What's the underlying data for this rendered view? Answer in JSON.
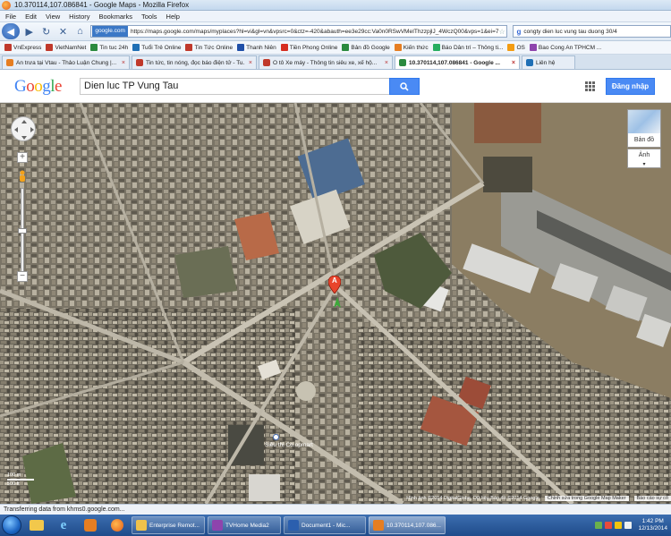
{
  "window": {
    "title": "10.370114,107.086841 - Google Maps - Mozilla Firefox"
  },
  "menu": [
    "File",
    "Edit",
    "View",
    "History",
    "Bookmarks",
    "Tools",
    "Help"
  ],
  "nav": {
    "site_label": "google.com",
    "url": "https://maps.google.com/maps/myplaces?hl=vi&gl=vn&vpsrc=0&ctz=-420&abauth=ee3e29cc:Va0n0RSwVMeIThzzpjlJ_4WczQ00&vps=1&ei=7",
    "search_value": "congty dien luc vung tau duong 30/4"
  },
  "bookmarks": [
    {
      "label": "VnExpress",
      "color": "#c0392b"
    },
    {
      "label": "VietNamNet",
      "color": "#c0392b"
    },
    {
      "label": "Tin tuc 24h",
      "color": "#2b8a3e"
    },
    {
      "label": "Tuổi Trẻ Online",
      "color": "#1f6fb5"
    },
    {
      "label": "Tin Tức Online",
      "color": "#c0392b"
    },
    {
      "label": "Thanh Niên",
      "color": "#1f4fa8"
    },
    {
      "label": "Tiền Phong Online",
      "color": "#d62d20"
    },
    {
      "label": "Bản đồ Google",
      "color": "#2b8a3e"
    },
    {
      "label": "Kiến thức",
      "color": "#e67e22"
    },
    {
      "label": "Báo Dân trí – Thông ti...",
      "color": "#27ae60"
    },
    {
      "label": "OS",
      "color": "#f39c12"
    },
    {
      "label": "Bao Cong An TPHCM ...",
      "color": "#8e44ad"
    }
  ],
  "tabs": [
    {
      "label": "Ăn trưa tại Vtau - Thảo Luận Chung |...",
      "color": "#e67e22",
      "active": false
    },
    {
      "label": "Tin tức, tin nóng, đọc báo điện tử - Tu...",
      "color": "#c0392b",
      "active": false
    },
    {
      "label": "Ô tô Xe máy - Thông tin siêu xe, xế hộ...",
      "color": "#c0392b",
      "active": false
    },
    {
      "label": "10.370114,107.086841 - Google ...",
      "color": "#2b8a3e",
      "active": true
    },
    {
      "label": "Liên hệ",
      "color": "#1f6fb5",
      "active": false
    }
  ],
  "google": {
    "logo": "Google",
    "search_value": "Dien luc TP Vung Tau",
    "signin_label": "Đăng nhập"
  },
  "map": {
    "maptype_map_label": "Bản đồ",
    "maptype_satellite_label": "Ảnh",
    "marker_label": "A",
    "place_label": "Siêu thị Co.opmart",
    "scale_label_1": "100 m",
    "scale_label_2": "500 ft",
    "copyright": "Hình ảnh ©2014 DigitalGlobe, Dữ liệu Bản đồ ©2014 Google",
    "footer_edit": "Chỉnh sửa trong Google Map Maker",
    "footer_report": "Báo cáo sự cố"
  },
  "status": {
    "text": "Transferring data from khms0.google.com..."
  },
  "taskbar": {
    "items": [
      {
        "label": "Enterprise Remot...",
        "color": "#f0c24b",
        "active": false
      },
      {
        "label": "TVHome Media2",
        "color": "#8e44ad",
        "active": false
      },
      {
        "label": "Document1 - Mic...",
        "color": "#2b5fae",
        "active": false
      },
      {
        "label": "10.370114,107.086...",
        "color": "#e67e22",
        "active": true
      }
    ],
    "time": "1:42 PM",
    "date": "12/13/2014"
  }
}
